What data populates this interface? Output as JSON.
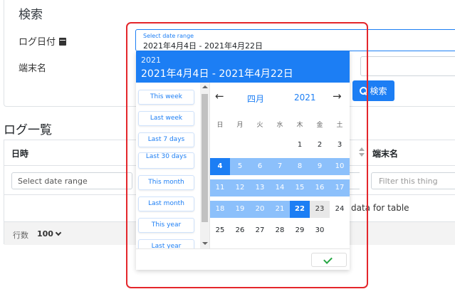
{
  "search": {
    "title": "検索",
    "date_label": "ログ日付",
    "device_label": "端末名",
    "button_label": "検索"
  },
  "log": {
    "title": "ログ一覧",
    "columns": [
      "日時",
      "端末名"
    ],
    "date_filter_placeholder": "Select date range",
    "device_filter_placeholder": "Filter this thing",
    "no_data_text": "data for table",
    "rows_label": "行数",
    "rows_value": "100"
  },
  "range_input": {
    "placeholder": "Select date range",
    "value": "2021年4月4日 - 2021年4月22日"
  },
  "picker": {
    "year": "2021",
    "range": "2021年4月4日 - 2021年4月22日",
    "presets": [
      "This week",
      "Last week",
      "Last 7 days",
      "Last 30 days",
      "This month",
      "Last month",
      "This year",
      "Last year"
    ],
    "month": "四月",
    "year_label": "2021",
    "prev": "←",
    "next": "→",
    "weekdays": [
      "日",
      "月",
      "火",
      "水",
      "木",
      "金",
      "土"
    ],
    "weeks": [
      [
        "",
        "",
        "",
        "",
        "1",
        "2",
        "3"
      ],
      [
        "4",
        "5",
        "6",
        "7",
        "8",
        "9",
        "10"
      ],
      [
        "11",
        "12",
        "13",
        "14",
        "15",
        "16",
        "17"
      ],
      [
        "18",
        "19",
        "20",
        "21",
        "22",
        "23",
        "24"
      ],
      [
        "25",
        "26",
        "27",
        "28",
        "29",
        "30",
        ""
      ]
    ],
    "range_start": 4,
    "range_end": 22,
    "today": 23
  },
  "colors": {
    "accent": "#1c7ef4",
    "range_fill": "#8cc0fb",
    "highlight": "#e4262b",
    "confirm": "#28a745"
  }
}
